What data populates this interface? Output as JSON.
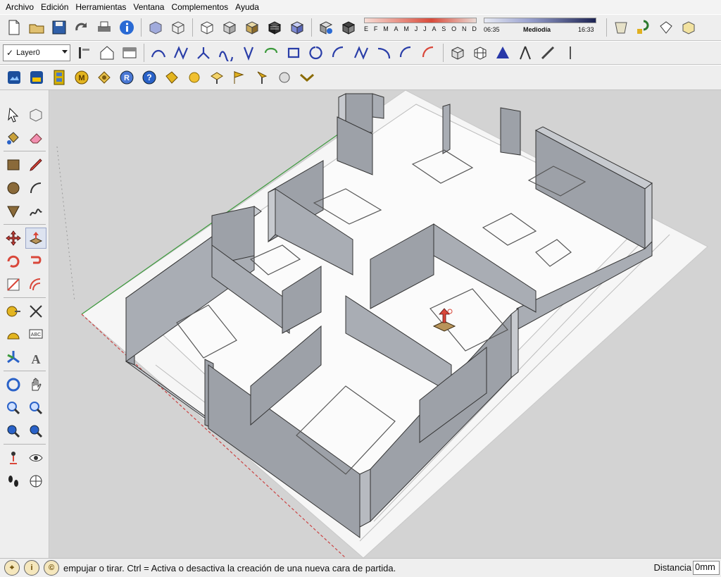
{
  "menu": [
    "Archivo",
    "Edición",
    "Herramientas",
    "Ventana",
    "Complementos",
    "Ayuda"
  ],
  "layer": {
    "current": "Layer0"
  },
  "shadow": {
    "months": [
      "E",
      "F",
      "M",
      "A",
      "M",
      "J",
      "J",
      "A",
      "S",
      "O",
      "N",
      "D"
    ],
    "time_start": "06:35",
    "time_mid": "Mediodía",
    "time_end": "16:33",
    "month_color": "#d84a3a",
    "time_color": "#1c2352"
  },
  "toolbar_icons": {
    "row1": [
      "new-icon",
      "open-icon",
      "save-icon",
      "redo-icon",
      "print-icon",
      "model-info-icon",
      "xray-icon",
      "wireframe-icon",
      "hidden-line-icon",
      "shaded-icon",
      "textured-icon",
      "monochrome-icon",
      "back-edges-icon",
      "iso-view-icon",
      "top-view-icon",
      "front-view-icon",
      "right-view-icon",
      "back-view-icon",
      "left-view-icon",
      "shadow-toggle-icon",
      "fog-icon",
      "components-icon",
      "sandbox-icon",
      "solid-tools-icon"
    ],
    "row2": [
      "home-icon",
      "section-plane-icon",
      "curve-tools-icon"
    ],
    "row3": [
      "photo-textures-icon",
      "add-location-icon",
      "film-strip-icon",
      "modeling-icon",
      "3d-warehouse-icon",
      "render-icon",
      "help-icon",
      "tag-icon",
      "sphere-icon",
      "sun-icon",
      "flag-icon",
      "light-icon",
      "material-icon",
      "arrows-icon"
    ]
  },
  "colors": {
    "wall_top": "#7a7f87",
    "wall_side": "#a7aab0",
    "floor": "#f4f4f4",
    "dimension": "#c8584a",
    "axis_green": "#3c9a3c",
    "axis_red": "#c44"
  },
  "status": {
    "text": "empujar o tirar. Ctrl = Activa o desactiva la creación de una nueva cara de partida.",
    "measure_label": "Distancia",
    "measure_value": "0mm"
  }
}
